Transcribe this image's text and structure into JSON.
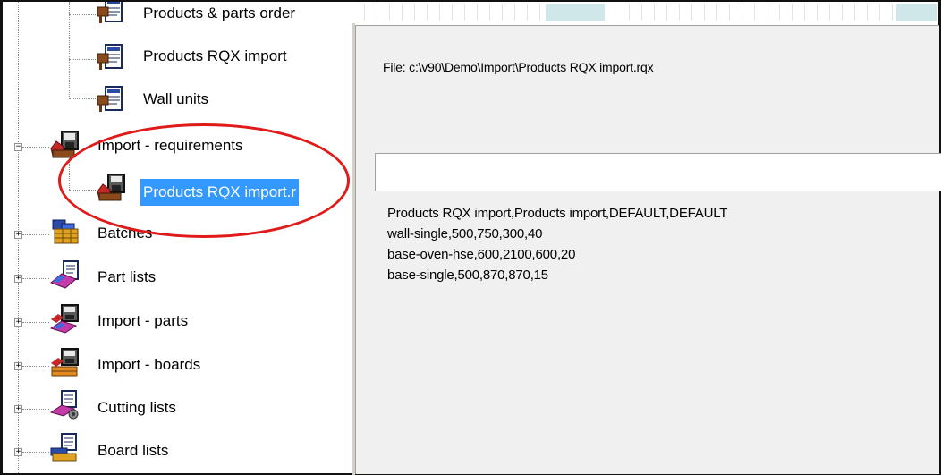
{
  "tree": {
    "nodes": [
      {
        "label": "Products & parts order",
        "icon": "report-icon"
      },
      {
        "label": "Products RQX import",
        "icon": "report-icon"
      },
      {
        "label": "Wall units",
        "icon": "report-icon"
      },
      {
        "label": "Import - requirements",
        "icon": "import-requirements-icon",
        "expander": "−"
      },
      {
        "label": "Products RQX import.r",
        "icon": "import-requirements-icon",
        "selected": true
      },
      {
        "label": "Batches",
        "icon": "batches-icon",
        "expander": "+"
      },
      {
        "label": "Part lists",
        "icon": "part-lists-icon",
        "expander": "+"
      },
      {
        "label": "Import - parts",
        "icon": "import-parts-icon",
        "expander": "+"
      },
      {
        "label": "Import - boards",
        "icon": "import-boards-icon",
        "expander": "+"
      },
      {
        "label": "Cutting lists",
        "icon": "cutting-lists-icon",
        "expander": "+"
      },
      {
        "label": "Board lists",
        "icon": "board-lists-icon",
        "expander": "+"
      }
    ]
  },
  "detail": {
    "file_label": "File: c:\\v90\\Demo\\Import\\Products RQX import.rqx",
    "lines": [
      "Products RQX import,Products import,DEFAULT,DEFAULT",
      "wall-single,500,750,300,40",
      "base-oven-hse,600,2100,600,20",
      "base-single,500,870,870,15"
    ]
  },
  "colors": {
    "selection": "#3399ff",
    "annotation": "#e01919",
    "pane_bg": "#f0f0f0"
  }
}
